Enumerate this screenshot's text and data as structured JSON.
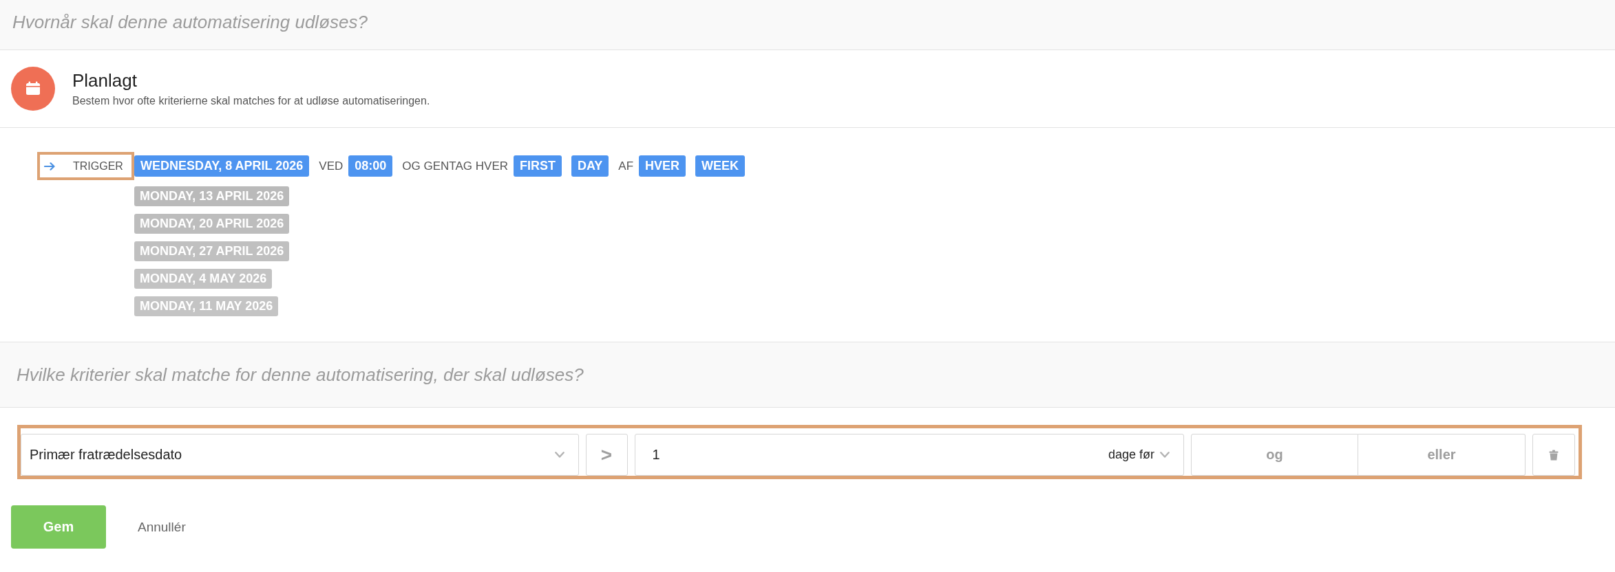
{
  "trigger_section": {
    "heading": "Hvornår skal denne automatisering udløses?"
  },
  "trigger_type": {
    "title": "Planlagt",
    "description": "Bestem hvor ofte kriterierne skal matches for at udløse automatiseringen."
  },
  "schedule": {
    "label": "TRIGGER",
    "highlighted": true,
    "parts": [
      {
        "kind": "value",
        "text": "WEDNESDAY, 8 APRIL 2026"
      },
      {
        "kind": "text",
        "text": "VED"
      },
      {
        "kind": "value",
        "text": "08:00"
      },
      {
        "kind": "text",
        "text": "OG GENTAG HVER"
      },
      {
        "kind": "value",
        "text": "FIRST"
      },
      {
        "kind": "value",
        "text": "DAY"
      },
      {
        "kind": "text",
        "text": "AF"
      },
      {
        "kind": "value",
        "text": "HVER"
      },
      {
        "kind": "value",
        "text": "WEEK"
      }
    ],
    "upcoming": [
      "MONDAY, 13 APRIL 2026",
      "MONDAY, 20 APRIL 2026",
      "MONDAY, 27 APRIL 2026",
      "MONDAY, 4 MAY 2026",
      "MONDAY, 11 MAY 2026"
    ]
  },
  "criteria_section": {
    "heading": "Hvilke kriterier skal matche for denne automatisering, der skal udløses?"
  },
  "criteria": [
    {
      "highlighted": true,
      "field": "Primær fratrædelsesdato",
      "operator": ">",
      "value": "1",
      "unit": "dage før",
      "connectors": [
        "og",
        "eller"
      ]
    }
  ],
  "actions": {
    "save": "Gem",
    "cancel": "Annullér"
  }
}
